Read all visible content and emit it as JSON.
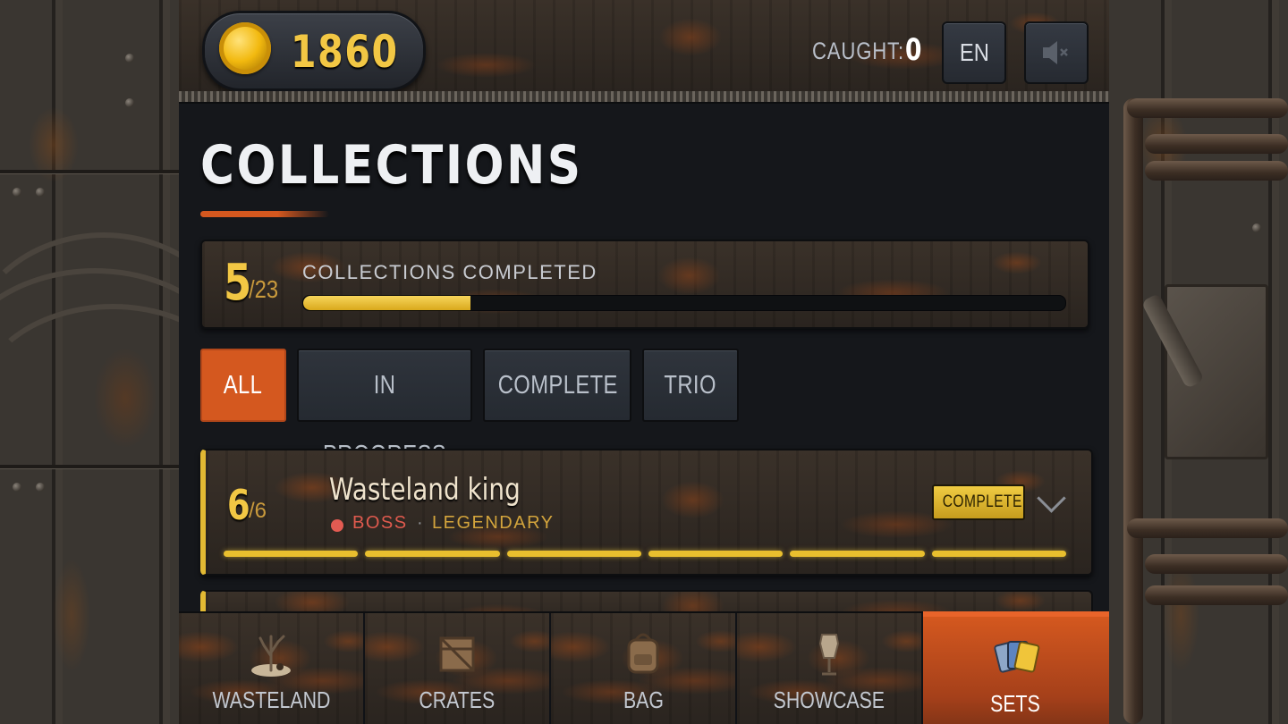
{
  "header": {
    "coins": "1860",
    "caught_label": "CAUGHT:",
    "caught_value": "0",
    "language": "EN",
    "mute_icon": "speaker-muted-icon"
  },
  "page": {
    "title": "COLLECTIONS"
  },
  "summary": {
    "completed": "5",
    "total": "/23",
    "label": "COLLECTIONS COMPLETED",
    "progress": 0.22
  },
  "filters": [
    {
      "label": "ALL",
      "active": true
    },
    {
      "label": "IN PROGRESS",
      "active": false
    },
    {
      "label": "COMPLETE",
      "active": false
    },
    {
      "label": "TRIO",
      "active": false
    }
  ],
  "collections": [
    {
      "count": "6",
      "total": "/6",
      "name": "Wasteland king",
      "category": "BOSS",
      "separator": "·",
      "rarity": "LEGENDARY",
      "badge": "COMPLETE",
      "segments_filled": 6,
      "segments_total": 6
    }
  ],
  "nav": [
    {
      "label": "WASTELAND",
      "icon": "dead-tree-icon",
      "active": false
    },
    {
      "label": "CRATES",
      "icon": "crate-icon",
      "active": false
    },
    {
      "label": "BAG",
      "icon": "backpack-icon",
      "active": false
    },
    {
      "label": "SHOWCASE",
      "icon": "mannequin-icon",
      "active": false
    },
    {
      "label": "SETS",
      "icon": "cards-icon",
      "active": true
    }
  ],
  "colors": {
    "accent": "#d4581f",
    "gold": "#f2c744",
    "boss": "#df5a4e",
    "legendary": "#d3a43c"
  }
}
